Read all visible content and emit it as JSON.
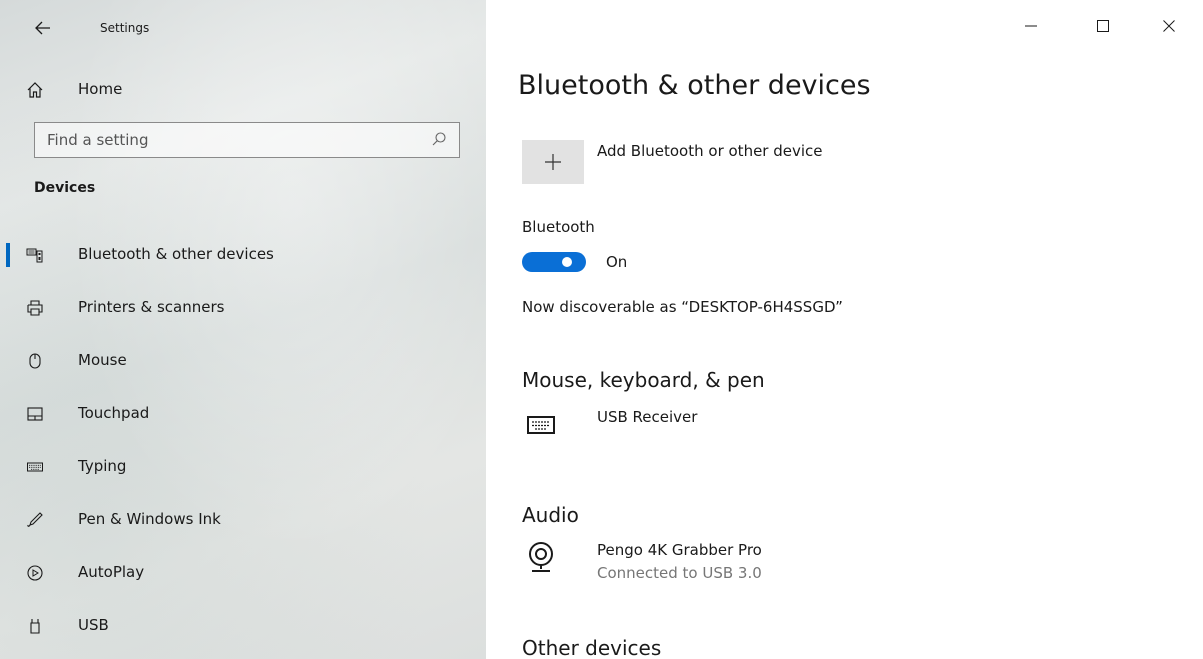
{
  "window": {
    "title": "Settings",
    "controls": {
      "minimize": "—",
      "maximize": "☐",
      "close": "✕"
    }
  },
  "sidebar": {
    "home_label": "Home",
    "search_placeholder": "Find a setting",
    "section_title": "Devices",
    "items": [
      {
        "label": "Bluetooth & other devices",
        "icon": "bluetooth-devices-icon",
        "active": true
      },
      {
        "label": "Printers & scanners",
        "icon": "printer-icon"
      },
      {
        "label": "Mouse",
        "icon": "mouse-icon"
      },
      {
        "label": "Touchpad",
        "icon": "touchpad-icon"
      },
      {
        "label": "Typing",
        "icon": "keyboard-icon"
      },
      {
        "label": "Pen & Windows Ink",
        "icon": "pen-icon"
      },
      {
        "label": "AutoPlay",
        "icon": "autoplay-icon"
      },
      {
        "label": "USB",
        "icon": "usb-icon"
      }
    ]
  },
  "main": {
    "title": "Bluetooth & other devices",
    "add_device_label": "Add Bluetooth or other device",
    "bluetooth": {
      "label": "Bluetooth",
      "state": "On"
    },
    "discoverable_text": "Now discoverable as “DESKTOP-6H4SSGD”",
    "groups": {
      "input": {
        "title": "Mouse, keyboard, & pen",
        "device": {
          "name": "USB Receiver",
          "icon": "keyboard-icon"
        }
      },
      "audio": {
        "title": "Audio",
        "device": {
          "name": "Pengo 4K Grabber Pro",
          "status": "Connected to USB 3.0",
          "icon": "webcam-icon"
        }
      },
      "other": {
        "title": "Other devices"
      }
    }
  },
  "colors": {
    "accent": "#0067c0",
    "toggle_on": "#0a6fd6",
    "secondary_text": "#767676"
  }
}
